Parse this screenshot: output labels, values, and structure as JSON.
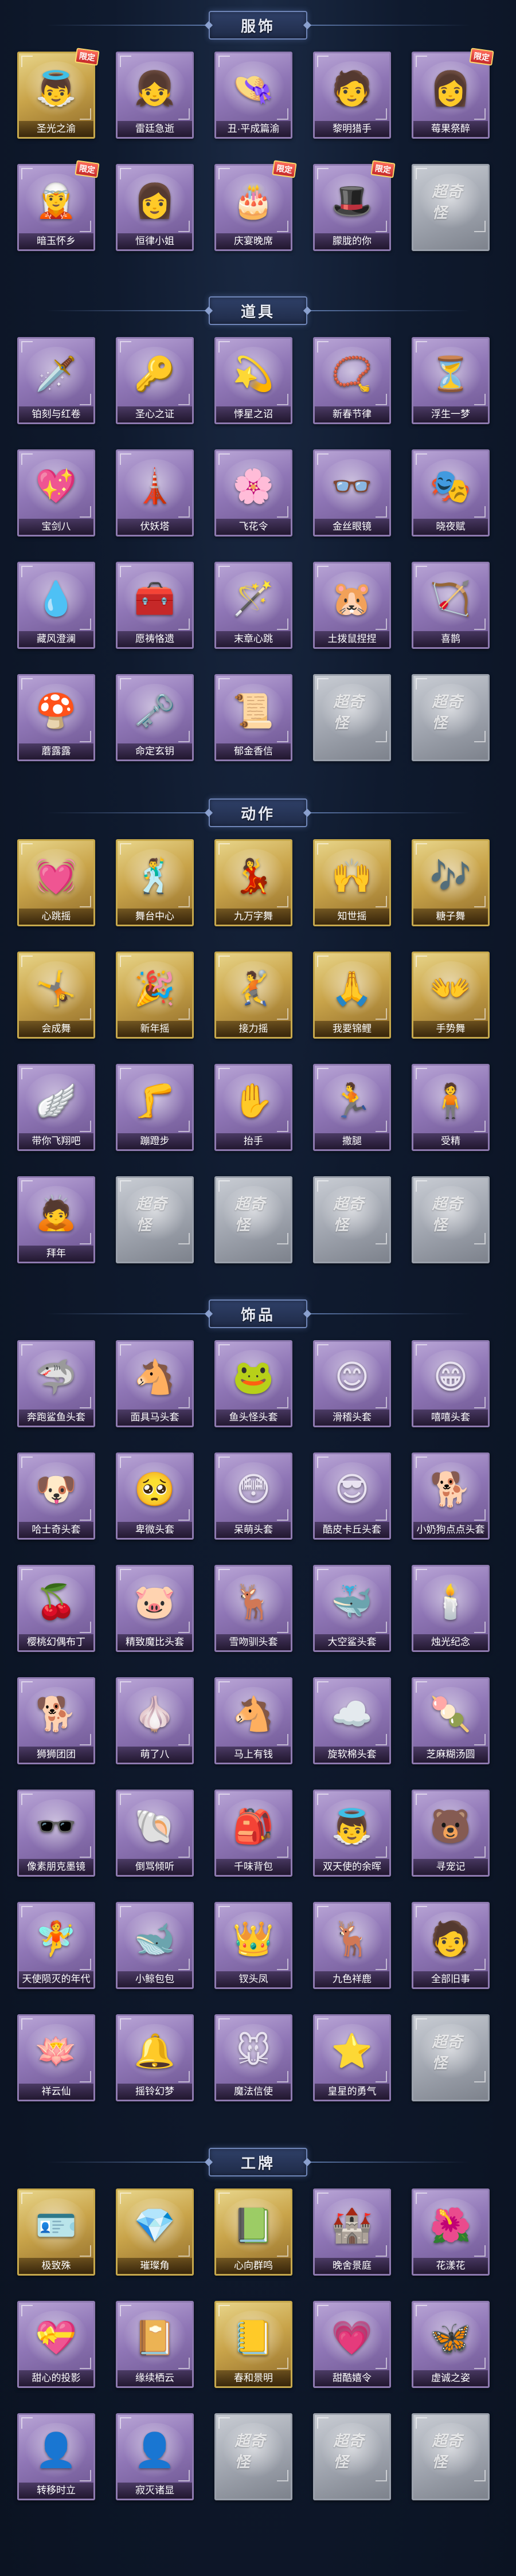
{
  "sections": [
    {
      "title": "服饰",
      "items": [
        {
          "name": "圣光之渝",
          "tier": "gold",
          "icon": "👼",
          "badge": "限定"
        },
        {
          "name": "雷廷急逝",
          "tier": "purple",
          "icon": "👧"
        },
        {
          "name": "丑·平成篇渝",
          "tier": "purple",
          "icon": "👒"
        },
        {
          "name": "黎明猎手",
          "tier": "purple",
          "icon": "🧑"
        },
        {
          "name": "莓果祭醉",
          "tier": "purple",
          "icon": "👩",
          "badge": "限定"
        },
        {
          "name": "暗玉怀乡",
          "tier": "purple",
          "icon": "🧝",
          "badge": "限定"
        },
        {
          "name": "恒律小姐",
          "tier": "purple",
          "icon": "👩"
        },
        {
          "name": "庆宴晚席",
          "tier": "purple",
          "icon": "🎂",
          "badge": "限定"
        },
        {
          "name": "朦胧的你",
          "tier": "purple",
          "icon": "🎩",
          "badge": "限定"
        },
        {
          "name": "",
          "tier": "empty",
          "icon": "超奇",
          "placeholder": "超奇怪"
        }
      ]
    },
    {
      "title": "道具",
      "items": [
        {
          "name": "铂刻与红卷",
          "tier": "purple",
          "icon": "🗡️"
        },
        {
          "name": "圣心之证",
          "tier": "purple",
          "icon": "🔑"
        },
        {
          "name": "悸星之诏",
          "tier": "purple",
          "icon": "💫"
        },
        {
          "name": "新春节律",
          "tier": "purple",
          "icon": "📿"
        },
        {
          "name": "浮生一梦",
          "tier": "purple",
          "icon": "⏳"
        },
        {
          "name": "宝剑八",
          "tier": "purple",
          "icon": "💖"
        },
        {
          "name": "伏妖塔",
          "tier": "purple",
          "icon": "🗼"
        },
        {
          "name": "飞花令",
          "tier": "purple",
          "icon": "🌸"
        },
        {
          "name": "金丝眼镜",
          "tier": "purple",
          "icon": "👓"
        },
        {
          "name": "晓夜赋",
          "tier": "purple",
          "icon": "🎭"
        },
        {
          "name": "藏风澄澜",
          "tier": "purple",
          "icon": "💧"
        },
        {
          "name": "愿祷恪遗",
          "tier": "purple",
          "icon": "🧰"
        },
        {
          "name": "末章心跳",
          "tier": "purple",
          "icon": "🪄"
        },
        {
          "name": "土拨鼠捏捏",
          "tier": "purple",
          "icon": "🐹"
        },
        {
          "name": "喜鹊",
          "tier": "purple",
          "icon": "🏹"
        },
        {
          "name": "蘑露露",
          "tier": "purple",
          "icon": "🍄"
        },
        {
          "name": "命定玄钥",
          "tier": "purple",
          "icon": "🗝️"
        },
        {
          "name": "郁金香信",
          "tier": "purple",
          "icon": "📜"
        },
        {
          "name": "",
          "tier": "empty",
          "icon": "",
          "placeholder": "超奇怪"
        },
        {
          "name": "",
          "tier": "empty",
          "icon": "",
          "placeholder": "超奇怪"
        }
      ]
    },
    {
      "title": "动作",
      "items": [
        {
          "name": "心跳摇",
          "tier": "gold",
          "icon": "💓"
        },
        {
          "name": "舞台中心",
          "tier": "gold",
          "icon": "🕺"
        },
        {
          "name": "九万字舞",
          "tier": "gold",
          "icon": "💃"
        },
        {
          "name": "知世摇",
          "tier": "gold",
          "icon": "🙌"
        },
        {
          "name": "糖子舞",
          "tier": "gold",
          "icon": "🎶"
        },
        {
          "name": "会成舞",
          "tier": "gold",
          "icon": "🤸"
        },
        {
          "name": "新年摇",
          "tier": "gold",
          "icon": "🎉"
        },
        {
          "name": "接力摇",
          "tier": "gold",
          "icon": "🤾"
        },
        {
          "name": "我要锦鲤",
          "tier": "gold",
          "icon": "🙏"
        },
        {
          "name": "手势舞",
          "tier": "gold",
          "icon": "👐"
        },
        {
          "name": "带你飞翔吧",
          "tier": "purple",
          "icon": "🪽"
        },
        {
          "name": "蹦蹬步",
          "tier": "purple",
          "icon": "🦵"
        },
        {
          "name": "抬手",
          "tier": "purple",
          "icon": "✋"
        },
        {
          "name": "撒腿",
          "tier": "purple",
          "icon": "🏃"
        },
        {
          "name": "受精",
          "tier": "purple",
          "icon": "🧍"
        },
        {
          "name": "拜年",
          "tier": "purple",
          "icon": "🙇"
        },
        {
          "name": "",
          "tier": "empty",
          "icon": "",
          "placeholder": "超奇怪"
        },
        {
          "name": "",
          "tier": "empty",
          "icon": "",
          "placeholder": "超奇怪"
        },
        {
          "name": "",
          "tier": "empty",
          "icon": "",
          "placeholder": "超奇怪"
        },
        {
          "name": "",
          "tier": "empty",
          "icon": "",
          "placeholder": "超奇怪"
        }
      ]
    },
    {
      "title": "饰品",
      "items": [
        {
          "name": "奔跑鲨鱼头套",
          "tier": "purple",
          "icon": "🦈"
        },
        {
          "name": "面具马头套",
          "tier": "purple",
          "icon": "🐴"
        },
        {
          "name": "鱼头怪头套",
          "tier": "purple",
          "icon": "🐸"
        },
        {
          "name": "滑稽头套",
          "tier": "purple",
          "icon": "😊"
        },
        {
          "name": "嘻嘻头套",
          "tier": "purple",
          "icon": "😁"
        },
        {
          "name": "哈士奇头套",
          "tier": "purple",
          "icon": "🐶"
        },
        {
          "name": "卑微头套",
          "tier": "purple",
          "icon": "🥺"
        },
        {
          "name": "呆萌头套",
          "tier": "purple",
          "icon": "😳"
        },
        {
          "name": "酷皮卡丘头套",
          "tier": "purple",
          "icon": "😎"
        },
        {
          "name": "小奶狗点点头套",
          "tier": "purple",
          "icon": "🐕"
        },
        {
          "name": "樱桃幻偶布丁",
          "tier": "purple",
          "icon": "🍒"
        },
        {
          "name": "精致魔比头套",
          "tier": "purple",
          "icon": "🐷"
        },
        {
          "name": "雪吻驯头套",
          "tier": "purple",
          "icon": "🦌"
        },
        {
          "name": "大空鲨头套",
          "tier": "purple",
          "icon": "🐳"
        },
        {
          "name": "烛光纪念",
          "tier": "purple",
          "icon": "🕯️"
        },
        {
          "name": "狮狮团团",
          "tier": "purple",
          "icon": "🐕"
        },
        {
          "name": "萌了八",
          "tier": "purple",
          "icon": "🧄"
        },
        {
          "name": "马上有钱",
          "tier": "purple",
          "icon": "🐴"
        },
        {
          "name": "旋软棉头套",
          "tier": "purple",
          "icon": "☁️"
        },
        {
          "name": "芝麻糊汤圆",
          "tier": "purple",
          "icon": "🍡"
        },
        {
          "name": "像素朋克墨镜",
          "tier": "purple",
          "icon": "🕶️"
        },
        {
          "name": "倒骂倾听",
          "tier": "purple",
          "icon": "🐚"
        },
        {
          "name": "千味背包",
          "tier": "purple",
          "icon": "🎒"
        },
        {
          "name": "双天使的余晖",
          "tier": "purple",
          "icon": "👼"
        },
        {
          "name": "寻宠记",
          "tier": "purple",
          "icon": "🐻"
        },
        {
          "name": "天使陨灭的年代",
          "tier": "purple",
          "icon": "🧚"
        },
        {
          "name": "小鲸包包",
          "tier": "purple",
          "icon": "🐋"
        },
        {
          "name": "钗头凤",
          "tier": "purple",
          "icon": "👑"
        },
        {
          "name": "九色祥鹿",
          "tier": "purple",
          "icon": "🦌"
        },
        {
          "name": "全部旧事",
          "tier": "purple",
          "icon": "🧑"
        },
        {
          "name": "祥云仙",
          "tier": "purple",
          "icon": "🪷"
        },
        {
          "name": "摇铃幻梦",
          "tier": "purple",
          "icon": "🔔"
        },
        {
          "name": "魔法信使",
          "tier": "purple",
          "icon": "🐭"
        },
        {
          "name": "皇星的勇气",
          "tier": "purple",
          "icon": "⭐"
        },
        {
          "name": "",
          "tier": "empty",
          "icon": "",
          "placeholder": "超奇怪"
        }
      ]
    },
    {
      "title": "工牌",
      "items": [
        {
          "name": "极致殊",
          "tier": "gold",
          "icon": "🪪"
        },
        {
          "name": "璀璨角",
          "tier": "gold",
          "icon": "💎"
        },
        {
          "name": "心向群鸣",
          "tier": "gold",
          "icon": "📗"
        },
        {
          "name": "晚舍景庭",
          "tier": "purple",
          "icon": "🏰"
        },
        {
          "name": "花漾花",
          "tier": "purple",
          "icon": "🌺"
        },
        {
          "name": "甜心的投影",
          "tier": "purple",
          "icon": "💝"
        },
        {
          "name": "缘续栖云",
          "tier": "purple",
          "icon": "📔"
        },
        {
          "name": "春和景明",
          "tier": "gold",
          "icon": "📒"
        },
        {
          "name": "甜酷嬉令",
          "tier": "purple",
          "icon": "💗"
        },
        {
          "name": "虚诚之姿",
          "tier": "purple",
          "icon": "🦋"
        },
        {
          "name": "转移时立",
          "tier": "purple",
          "icon": "👤"
        },
        {
          "name": "寂灭诸显",
          "tier": "purple",
          "icon": "👤"
        },
        {
          "name": "",
          "tier": "empty",
          "icon": "",
          "placeholder": "超奇怪"
        },
        {
          "name": "",
          "tier": "empty",
          "icon": "",
          "placeholder": "超奇怪"
        },
        {
          "name": "",
          "tier": "empty",
          "icon": "",
          "placeholder": "超奇怪"
        }
      ]
    }
  ],
  "colors": {
    "background": "#0f1a2e",
    "gold_frame": "#c6a84c",
    "purple_frame": "#8e7ab0",
    "empty_frame": "#9aa0ab"
  }
}
